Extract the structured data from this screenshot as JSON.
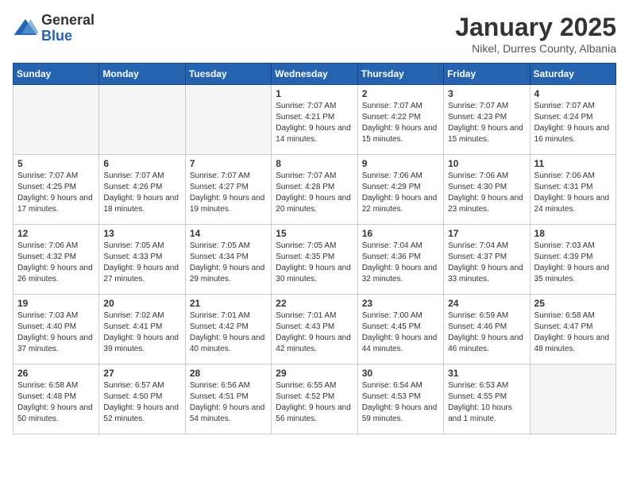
{
  "logo": {
    "general": "General",
    "blue": "Blue"
  },
  "title": {
    "month": "January 2025",
    "location": "Nikel, Durres County, Albania"
  },
  "weekdays": [
    "Sunday",
    "Monday",
    "Tuesday",
    "Wednesday",
    "Thursday",
    "Friday",
    "Saturday"
  ],
  "weeks": [
    [
      {
        "day": "",
        "empty": true
      },
      {
        "day": "",
        "empty": true
      },
      {
        "day": "",
        "empty": true
      },
      {
        "day": "1",
        "sunrise": "7:07 AM",
        "sunset": "4:21 PM",
        "daylight": "9 hours and 14 minutes."
      },
      {
        "day": "2",
        "sunrise": "7:07 AM",
        "sunset": "4:22 PM",
        "daylight": "9 hours and 15 minutes."
      },
      {
        "day": "3",
        "sunrise": "7:07 AM",
        "sunset": "4:23 PM",
        "daylight": "9 hours and 15 minutes."
      },
      {
        "day": "4",
        "sunrise": "7:07 AM",
        "sunset": "4:24 PM",
        "daylight": "9 hours and 16 minutes."
      }
    ],
    [
      {
        "day": "5",
        "sunrise": "7:07 AM",
        "sunset": "4:25 PM",
        "daylight": "9 hours and 17 minutes."
      },
      {
        "day": "6",
        "sunrise": "7:07 AM",
        "sunset": "4:26 PM",
        "daylight": "9 hours and 18 minutes."
      },
      {
        "day": "7",
        "sunrise": "7:07 AM",
        "sunset": "4:27 PM",
        "daylight": "9 hours and 19 minutes."
      },
      {
        "day": "8",
        "sunrise": "7:07 AM",
        "sunset": "4:28 PM",
        "daylight": "9 hours and 20 minutes."
      },
      {
        "day": "9",
        "sunrise": "7:06 AM",
        "sunset": "4:29 PM",
        "daylight": "9 hours and 22 minutes."
      },
      {
        "day": "10",
        "sunrise": "7:06 AM",
        "sunset": "4:30 PM",
        "daylight": "9 hours and 23 minutes."
      },
      {
        "day": "11",
        "sunrise": "7:06 AM",
        "sunset": "4:31 PM",
        "daylight": "9 hours and 24 minutes."
      }
    ],
    [
      {
        "day": "12",
        "sunrise": "7:06 AM",
        "sunset": "4:32 PM",
        "daylight": "9 hours and 26 minutes."
      },
      {
        "day": "13",
        "sunrise": "7:05 AM",
        "sunset": "4:33 PM",
        "daylight": "9 hours and 27 minutes."
      },
      {
        "day": "14",
        "sunrise": "7:05 AM",
        "sunset": "4:34 PM",
        "daylight": "9 hours and 29 minutes."
      },
      {
        "day": "15",
        "sunrise": "7:05 AM",
        "sunset": "4:35 PM",
        "daylight": "9 hours and 30 minutes."
      },
      {
        "day": "16",
        "sunrise": "7:04 AM",
        "sunset": "4:36 PM",
        "daylight": "9 hours and 32 minutes."
      },
      {
        "day": "17",
        "sunrise": "7:04 AM",
        "sunset": "4:37 PM",
        "daylight": "9 hours and 33 minutes."
      },
      {
        "day": "18",
        "sunrise": "7:03 AM",
        "sunset": "4:39 PM",
        "daylight": "9 hours and 35 minutes."
      }
    ],
    [
      {
        "day": "19",
        "sunrise": "7:03 AM",
        "sunset": "4:40 PM",
        "daylight": "9 hours and 37 minutes."
      },
      {
        "day": "20",
        "sunrise": "7:02 AM",
        "sunset": "4:41 PM",
        "daylight": "9 hours and 39 minutes."
      },
      {
        "day": "21",
        "sunrise": "7:01 AM",
        "sunset": "4:42 PM",
        "daylight": "9 hours and 40 minutes."
      },
      {
        "day": "22",
        "sunrise": "7:01 AM",
        "sunset": "4:43 PM",
        "daylight": "9 hours and 42 minutes."
      },
      {
        "day": "23",
        "sunrise": "7:00 AM",
        "sunset": "4:45 PM",
        "daylight": "9 hours and 44 minutes."
      },
      {
        "day": "24",
        "sunrise": "6:59 AM",
        "sunset": "4:46 PM",
        "daylight": "9 hours and 46 minutes."
      },
      {
        "day": "25",
        "sunrise": "6:58 AM",
        "sunset": "4:47 PM",
        "daylight": "9 hours and 48 minutes."
      }
    ],
    [
      {
        "day": "26",
        "sunrise": "6:58 AM",
        "sunset": "4:48 PM",
        "daylight": "9 hours and 50 minutes."
      },
      {
        "day": "27",
        "sunrise": "6:57 AM",
        "sunset": "4:50 PM",
        "daylight": "9 hours and 52 minutes."
      },
      {
        "day": "28",
        "sunrise": "6:56 AM",
        "sunset": "4:51 PM",
        "daylight": "9 hours and 54 minutes."
      },
      {
        "day": "29",
        "sunrise": "6:55 AM",
        "sunset": "4:52 PM",
        "daylight": "9 hours and 56 minutes."
      },
      {
        "day": "30",
        "sunrise": "6:54 AM",
        "sunset": "4:53 PM",
        "daylight": "9 hours and 59 minutes."
      },
      {
        "day": "31",
        "sunrise": "6:53 AM",
        "sunset": "4:55 PM",
        "daylight": "10 hours and 1 minute."
      },
      {
        "day": "",
        "empty": true
      }
    ]
  ]
}
